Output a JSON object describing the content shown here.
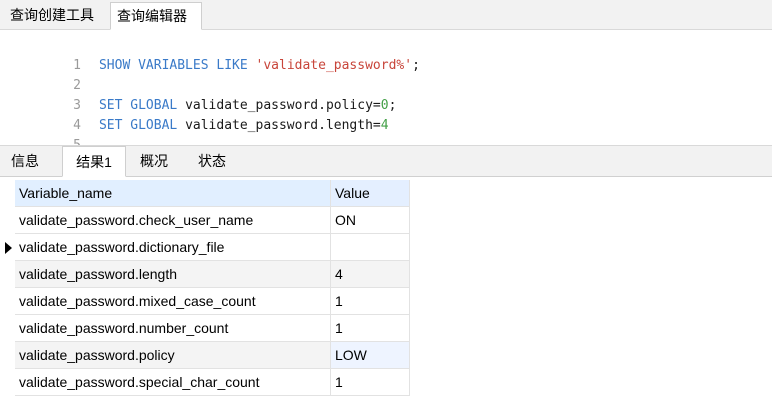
{
  "top_tabs": {
    "create_tool": "查询创建工具",
    "editor": "查询编辑器"
  },
  "editor": {
    "lines": [
      {
        "no": "1",
        "parts": [
          {
            "kind": "kw",
            "text": "SHOW VARIABLES LIKE "
          },
          {
            "kind": "str",
            "text": "'validate_password%'"
          },
          {
            "kind": "plain",
            "text": ";"
          }
        ]
      },
      {
        "no": "2",
        "parts": []
      },
      {
        "no": "3",
        "parts": [
          {
            "kind": "kw",
            "text": "SET GLOBAL "
          },
          {
            "kind": "plain",
            "text": "validate_password.policy="
          },
          {
            "kind": "num",
            "text": "0"
          },
          {
            "kind": "plain",
            "text": ";"
          }
        ]
      },
      {
        "no": "4",
        "parts": [
          {
            "kind": "kw",
            "text": "SET GLOBAL "
          },
          {
            "kind": "plain",
            "text": "validate_password.length="
          },
          {
            "kind": "num",
            "text": "4"
          }
        ]
      },
      {
        "no": "5",
        "parts": []
      }
    ]
  },
  "result_tabs": {
    "info": "信息",
    "result1": "结果1",
    "overview": "概况",
    "status": "状态"
  },
  "grid": {
    "headers": {
      "name": "Variable_name",
      "value": "Value"
    },
    "rows": [
      {
        "name": "validate_password.check_user_name",
        "value": "ON"
      },
      {
        "name": "validate_password.dictionary_file",
        "value": ""
      },
      {
        "name": "validate_password.length",
        "value": "4"
      },
      {
        "name": "validate_password.mixed_case_count",
        "value": "1"
      },
      {
        "name": "validate_password.number_count",
        "value": "1"
      },
      {
        "name": "validate_password.policy",
        "value": "LOW"
      },
      {
        "name": "validate_password.special_char_count",
        "value": "1"
      }
    ]
  },
  "colors": {
    "keyword": "#3a7ac8",
    "string": "#c8453a",
    "number": "#43a047",
    "header_bg": "#e4efff"
  },
  "icons": {
    "current_row": "row-pointer-icon"
  }
}
